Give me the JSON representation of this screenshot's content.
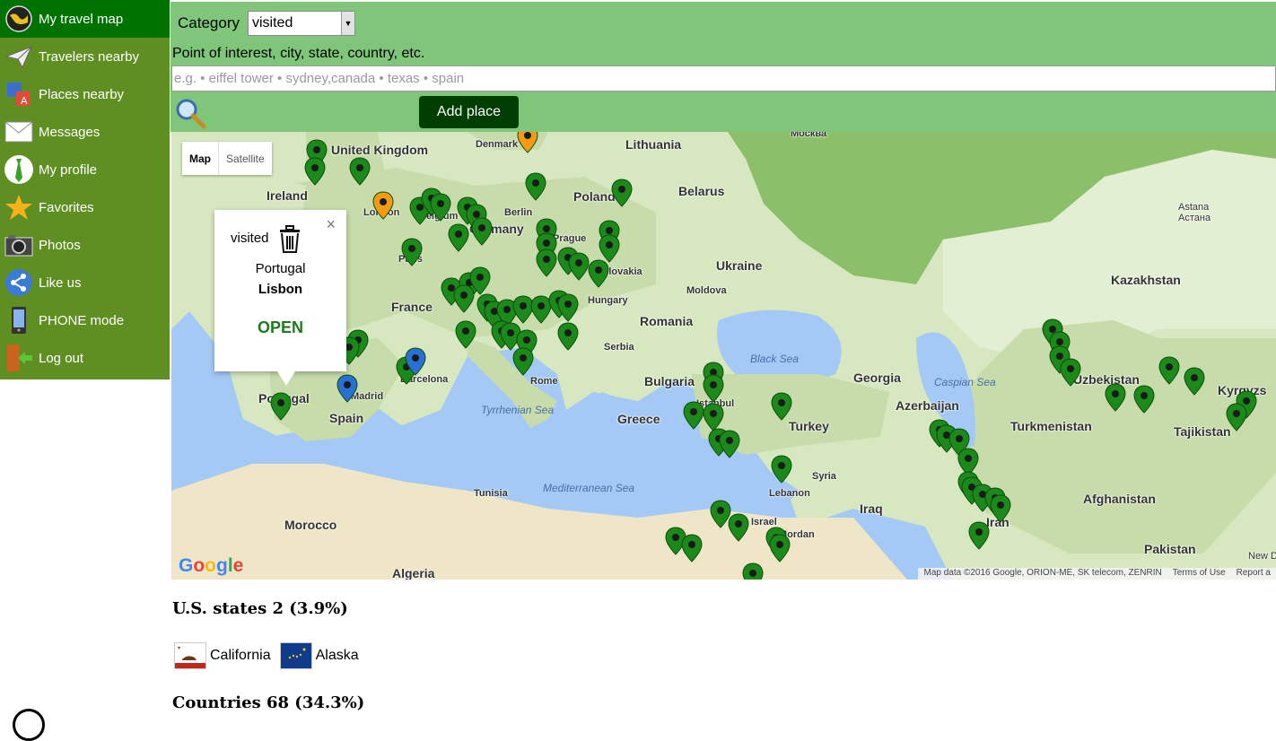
{
  "sidebar": {
    "items": [
      {
        "label": "My travel map",
        "icon": "globe-icon",
        "active": true
      },
      {
        "label": "Travelers nearby",
        "icon": "paper-plane-icon"
      },
      {
        "label": "Places nearby",
        "icon": "translate-icon"
      },
      {
        "label": "Messages",
        "icon": "envelope-icon"
      },
      {
        "label": "My profile",
        "icon": "tie-icon"
      },
      {
        "label": "Favorites",
        "icon": "star-icon"
      },
      {
        "label": "Photos",
        "icon": "camera-icon"
      },
      {
        "label": "Like us",
        "icon": "share-icon"
      },
      {
        "label": "PHONE mode",
        "icon": "phone-icon"
      },
      {
        "label": "Log out",
        "icon": "logout-door-icon"
      }
    ]
  },
  "form": {
    "category_label": "Category",
    "category_value": "visited",
    "poi_label": "Point of interest, city, state, country, etc.",
    "poi_placeholder": "e.g. • eiffel tower • sydney,canada • texas • spain",
    "add_button": "Add place"
  },
  "map": {
    "type_map": "Map",
    "type_satellite": "Satellite",
    "labels": {
      "denmark": "Denmark",
      "lithuania": "Lithuania",
      "moscow": "Москва",
      "united_kingdom": "United Kingdom",
      "ireland": "Ireland",
      "london": "London",
      "berlin": "Berlin",
      "germany": "Germany",
      "belgium": "Belgium",
      "poland": "Poland",
      "belarus": "Belarus",
      "prague": "Prague",
      "paris": "Paris",
      "slovakia": "Slovakia",
      "ukraine": "Ukraine",
      "moldova": "Moldova",
      "france": "France",
      "hungary": "Hungary",
      "romania": "Romania",
      "serbia": "Serbia",
      "black_sea": "Black Sea",
      "bulgaria": "Bulgaria",
      "istanbul": "Istanbul",
      "georgia": "Georgia",
      "caspian_sea": "Caspian Sea",
      "azerbaijan": "Azerbaijan",
      "portugal": "Portugal",
      "madrid": "Madrid",
      "barcelona": "Barcelona",
      "spain": "Spain",
      "rome": "Rome",
      "tyrrhenian_sea": "Tyrrhenian Sea",
      "greece": "Greece",
      "turkey": "Turkey",
      "turkmenistan": "Turkmenistan",
      "kazakhstan": "Kazakhstan",
      "astana": "Astana",
      "astana_ru": "Астана",
      "uzbekistan": "Uzbekistan",
      "kyrgyzstan": "Kyrgyzs",
      "tajikistan": "Tajikistan",
      "tunisia": "Tunisia",
      "mediterranean_sea": "Mediterranean Sea",
      "syria": "Syria",
      "lebanon": "Lebanon",
      "iraq": "Iraq",
      "israel": "Israel",
      "jordan": "Jordan",
      "iran": "Iran",
      "afghanistan": "Afghanistan",
      "pakistan": "Pakistan",
      "morocco": "Morocco",
      "algeria": "Algeria",
      "new_delhi": "New Del",
      "google": "Google"
    },
    "popup": {
      "status": "visited",
      "country": "Portugal",
      "city": "Lisbon",
      "open": "OPEN",
      "close": "×"
    },
    "attribution": "Map data ©2016 Google, ORION-ME, SK telecom, ZENRIN",
    "terms": "Terms of Use",
    "report": "Report a",
    "colors": {
      "visited_pin": "#1b8a1b",
      "wish_pin": "#f39c12",
      "home_pin": "#2a6fd6",
      "water": "#a5c9f5",
      "land": "#d7e8c0"
    }
  },
  "states": {
    "title": "U.S. states 2 (3.9%)",
    "items": [
      {
        "name": "California",
        "flag": "california-flag"
      },
      {
        "name": "Alaska",
        "flag": "alaska-flag"
      }
    ]
  },
  "countries": {
    "title": "Countries 68 (34.3%)"
  }
}
